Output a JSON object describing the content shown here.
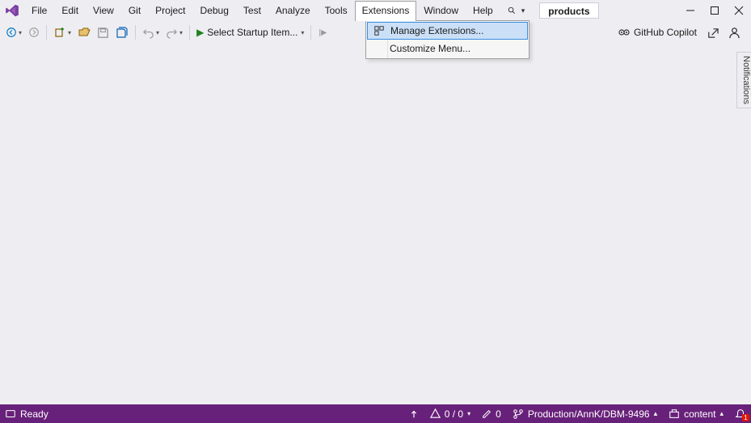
{
  "menu": {
    "items": [
      "File",
      "Edit",
      "View",
      "Git",
      "Project",
      "Debug",
      "Test",
      "Analyze",
      "Tools",
      "Extensions",
      "Window",
      "Help"
    ],
    "open_index": 9
  },
  "dropdown": {
    "items": [
      {
        "label": "Manage Extensions...",
        "has_icon": true,
        "highlight": true
      },
      {
        "label": "Customize Menu...",
        "has_icon": false,
        "highlight": false
      }
    ]
  },
  "solution_name": "products",
  "toolbar": {
    "startup_label": "Select Startup Item...",
    "copilot_label": "GitHub Copilot"
  },
  "notifications_tab": "Notifications",
  "statusbar": {
    "ready": "Ready",
    "errors": "0 / 0",
    "edits": "0",
    "branch": "Production/AnnK/DBM-9496",
    "repo": "content",
    "bell_count": "1"
  }
}
